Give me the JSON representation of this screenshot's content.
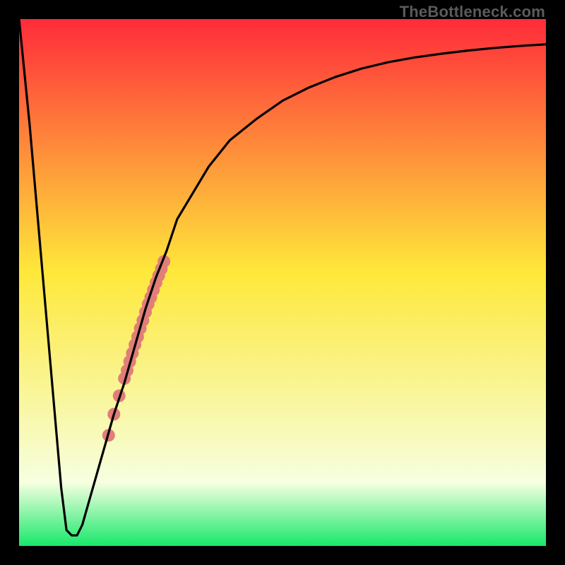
{
  "watermark": "TheBottleneck.com",
  "chart_data": {
    "type": "line",
    "title": "",
    "xlabel": "",
    "ylabel": "",
    "xlim": [
      0,
      100
    ],
    "ylim": [
      0,
      100
    ],
    "grid": false,
    "legend": false,
    "background_gradient": {
      "top_color": "#ff2b3a",
      "mid_color": "#fee83a",
      "near_bottom_color": "#f6ffe0",
      "bottom_color": "#17e86b"
    },
    "series": [
      {
        "name": "bottleneck-curve",
        "color": "#000000",
        "x": [
          0,
          2,
          4,
          6,
          8,
          9,
          10,
          11,
          12,
          14,
          16,
          18,
          20,
          22,
          24,
          26,
          28,
          30,
          33,
          36,
          40,
          45,
          50,
          55,
          60,
          65,
          70,
          75,
          80,
          85,
          90,
          95,
          100
        ],
        "y": [
          100,
          80,
          57,
          34,
          11,
          3,
          2,
          2,
          4,
          11,
          18,
          25,
          31,
          38,
          45,
          51,
          56,
          62,
          67,
          72,
          77,
          81,
          84.5,
          87,
          89,
          90.6,
          91.8,
          92.7,
          93.4,
          94,
          94.5,
          94.9,
          95.2
        ]
      }
    ],
    "highlight_points": {
      "name": "highlighted-range",
      "color": "#e17e78",
      "points": [
        {
          "x": 17.0,
          "y": 21.0
        },
        {
          "x": 18.0,
          "y": 25.0
        },
        {
          "x": 19.0,
          "y": 28.5
        },
        {
          "x": 20.0,
          "y": 31.8
        },
        {
          "x": 20.5,
          "y": 33.3
        },
        {
          "x": 21.0,
          "y": 35.0
        },
        {
          "x": 21.5,
          "y": 36.6
        },
        {
          "x": 22.0,
          "y": 38.2
        },
        {
          "x": 22.5,
          "y": 39.7
        },
        {
          "x": 23.0,
          "y": 41.3
        },
        {
          "x": 23.5,
          "y": 42.8
        },
        {
          "x": 24.0,
          "y": 44.4
        },
        {
          "x": 24.5,
          "y": 45.9
        },
        {
          "x": 25.0,
          "y": 47.2
        },
        {
          "x": 25.5,
          "y": 48.6
        },
        {
          "x": 26.0,
          "y": 50.0
        },
        {
          "x": 26.5,
          "y": 51.3
        },
        {
          "x": 27.0,
          "y": 52.6
        },
        {
          "x": 27.5,
          "y": 54.0
        }
      ]
    }
  }
}
